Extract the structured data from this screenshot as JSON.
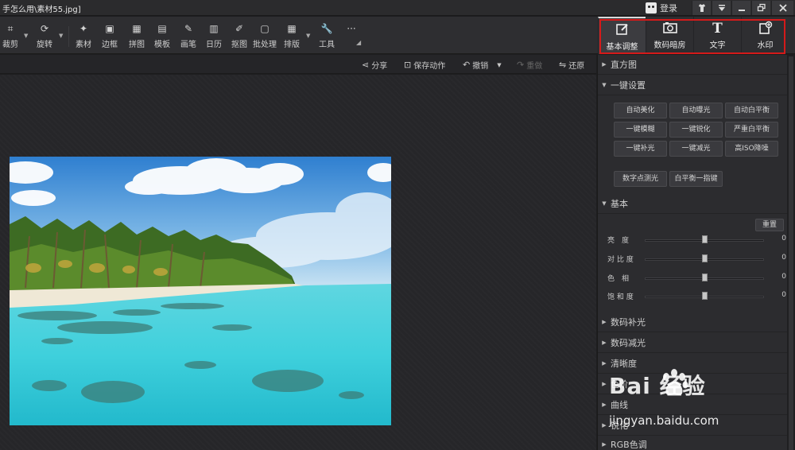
{
  "window": {
    "title": "手怎么用\\素材55.jpg]",
    "login_label": "登录"
  },
  "toolbar": {
    "tools": [
      {
        "label": "裁剪",
        "icon": "crop-icon"
      },
      {
        "label": "旋转",
        "icon": "rotate-icon"
      },
      {
        "label": "素材",
        "icon": "star-icon"
      },
      {
        "label": "边框",
        "icon": "frame-icon"
      },
      {
        "label": "拼图",
        "icon": "grid-icon"
      },
      {
        "label": "模板",
        "icon": "template-icon"
      },
      {
        "label": "画笔",
        "icon": "brush-icon"
      },
      {
        "label": "日历",
        "icon": "calendar-icon"
      },
      {
        "label": "抠图",
        "icon": "pin-icon"
      },
      {
        "label": "批处理",
        "icon": "batch-icon"
      },
      {
        "label": "排版",
        "icon": "layout-icon"
      },
      {
        "label": "工具",
        "icon": "wrench-icon"
      },
      {
        "label": "···",
        "icon": "more-icon"
      }
    ],
    "right_tabs": [
      {
        "label": "基本调整",
        "icon": "edit-icon"
      },
      {
        "label": "数码暗房",
        "icon": "camera-icon"
      },
      {
        "label": "文字",
        "icon": "text-icon"
      },
      {
        "label": "水印",
        "icon": "watermark-icon"
      }
    ]
  },
  "actions": {
    "share": "分享",
    "save_action": "保存动作",
    "undo": "撤销",
    "redo": "重做",
    "restore": "还原"
  },
  "panel": {
    "histogram": "直方图",
    "oneclick": "一键设置",
    "oneclick_buttons": [
      "自动美化",
      "自动曝光",
      "自动白平衡",
      "一键模糊",
      "一键锐化",
      "严重白平衡",
      "一键补光",
      "一键减光",
      "高ISO降噪"
    ],
    "extra_buttons": [
      "数字点测光",
      "白平衡一指键"
    ],
    "basic": "基本",
    "reset": "重置",
    "sliders": [
      {
        "name": "亮　度",
        "value": "0",
        "level": 0.5
      },
      {
        "name": "对 比 度",
        "value": "0",
        "level": 0.5
      },
      {
        "name": "色　相",
        "value": "0",
        "level": 0.5
      },
      {
        "name": "饱 和 度",
        "value": "0",
        "level": 0.5
      }
    ],
    "collapsed_sections": [
      "数码补光",
      "数码减光",
      "清晰度",
      "色阶",
      "曲线",
      "锐化",
      "RGB色调"
    ]
  },
  "watermark": {
    "brand": "Bai 经验",
    "url": "jingyan.baidu.com"
  }
}
